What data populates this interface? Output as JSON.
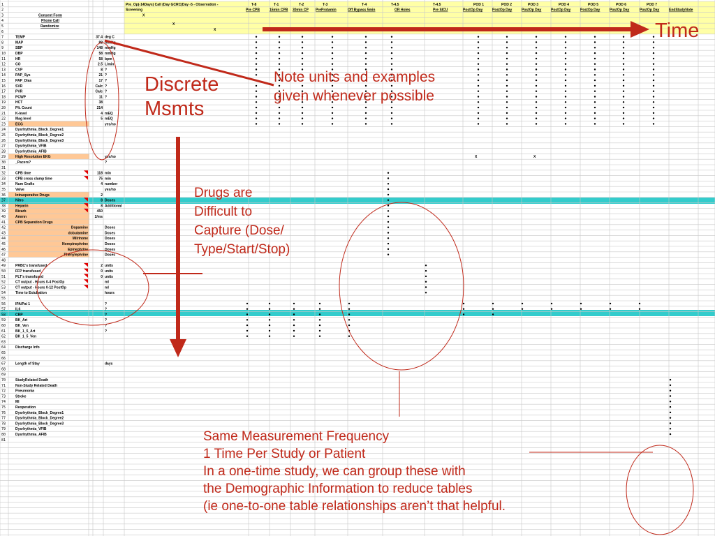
{
  "sheet": {
    "header_row1": "Pre_Op(-14Days) Call (Day GCRC(Day -5 - Observation -",
    "header_row2": "Screening",
    "header_mark": "X",
    "row_labels": {
      "consent": "Consent Form",
      "phone": "Phone Call",
      "randomize": "Randomize"
    },
    "time_columns": [
      "T-8",
      "T-1",
      "T-2",
      "T-3",
      "T-4",
      "T-4.5",
      "T-4.5",
      "POD 1",
      "POD 2",
      "POD 3",
      "POD 4",
      "POD 5",
      "POD 6",
      "POD 7"
    ],
    "subheaders": [
      "Pre CPB",
      "15min CPB",
      "30min CP",
      "PreProtamin",
      "Off Bypass 5min",
      "OR Holes",
      "Pre SICU",
      "PostOp Day",
      "PostOp Day",
      "PostOp Day",
      "PostOp Day",
      "PostOp Day",
      "PostOp Day",
      "PostOp Day",
      "EndStudyNote"
    ],
    "rows": [
      {
        "n": "7",
        "label": "TEMP",
        "val": "37.4",
        "unit": "deg C"
      },
      {
        "n": "8",
        "label": "MAP",
        "val": "88",
        "unit": "mmHg"
      },
      {
        "n": "9",
        "label": "SBP",
        "val": "148",
        "unit": "mmHg"
      },
      {
        "n": "10",
        "label": "DBP",
        "val": "58",
        "unit": "mmHg"
      },
      {
        "n": "11",
        "label": "HR",
        "val": "58",
        "unit": "bpm"
      },
      {
        "n": "12",
        "label": "CO",
        "val": "2.5",
        "unit": "L/min"
      },
      {
        "n": "13",
        "label": "CVP",
        "val": "8",
        "unit": "?"
      },
      {
        "n": "14",
        "label": "PAP_Sys",
        "val": "21",
        "unit": "?"
      },
      {
        "n": "15",
        "label": "PAP_Dias",
        "val": "17",
        "unit": "?"
      },
      {
        "n": "16",
        "label": "SVR",
        "val": "Calc",
        "unit": "?"
      },
      {
        "n": "17",
        "label": "PVR",
        "val": "Calc",
        "unit": "?"
      },
      {
        "n": "18",
        "label": "PCWP",
        "val": "11",
        "unit": "?"
      },
      {
        "n": "19",
        "label": "HCT",
        "val": "38",
        "unit": ""
      },
      {
        "n": "20",
        "label": "Plt. Count",
        "val": "214",
        "unit": ""
      },
      {
        "n": "21",
        "label": "K-level",
        "val": "4",
        "unit": "mEQ"
      },
      {
        "n": "22",
        "label": "Mag level",
        "val": "5",
        "unit": "mEQ"
      },
      {
        "n": "23",
        "label": "ECG",
        "val": "",
        "unit": "yes/no"
      },
      {
        "n": "24",
        "label": "Dysrhythmia_Block_Degree1",
        "val": "",
        "unit": ""
      },
      {
        "n": "25",
        "label": "Dysrhythmia_Block_Degree2",
        "val": "",
        "unit": ""
      },
      {
        "n": "26",
        "label": "Dysrhythmia_Block_Degree3",
        "val": "",
        "unit": ""
      },
      {
        "n": "27",
        "label": "Dysrhythmia_VFIB",
        "val": "",
        "unit": ""
      },
      {
        "n": "28",
        "label": "Dysrhythmia_AFIB",
        "val": "",
        "unit": ""
      },
      {
        "n": "29",
        "label": "High Resolution EKG",
        "val": "",
        "unit": "yes/no"
      },
      {
        "n": "30",
        "label": "_Pacers?",
        "val": "",
        "unit": "?"
      },
      {
        "n": "31",
        "label": "",
        "val": "",
        "unit": ""
      },
      {
        "n": "32",
        "label": "CPB time",
        "val": "118",
        "unit": "min"
      },
      {
        "n": "33",
        "label": "CPB cross clamp time",
        "val": "75",
        "unit": "min"
      },
      {
        "n": "34",
        "label": "Num Grafts",
        "val": "4",
        "unit": "number"
      },
      {
        "n": "35",
        "label": "Valve",
        "val": "",
        "unit": "yes/no"
      },
      {
        "n": "36",
        "label": "Intraoperative Drugs",
        "val": "2",
        "unit": ""
      },
      {
        "n": "37",
        "label": "Nitro",
        "val": "8",
        "unit": "Doses"
      },
      {
        "n": "38",
        "label": "Heparin",
        "val": "8",
        "unit": "Additional"
      },
      {
        "n": "39",
        "label": "Bicarb",
        "val": "450",
        "unit": ""
      },
      {
        "n": "40",
        "label": "Amrnn",
        "val": "2/ms",
        "unit": ""
      },
      {
        "n": "41",
        "label": "CPB Separation Drugs",
        "val": "",
        "unit": ""
      },
      {
        "n": "42",
        "label": "Dopamine",
        "val": "",
        "unit": "Doses"
      },
      {
        "n": "43",
        "label": "dobutamine",
        "val": "",
        "unit": "Doses"
      },
      {
        "n": "44",
        "label": "Milrinone",
        "val": "",
        "unit": "Doses"
      },
      {
        "n": "45",
        "label": "Norepinephrine",
        "val": "",
        "unit": "Doses"
      },
      {
        "n": "46",
        "label": "Epinephrine",
        "val": "",
        "unit": "Doses"
      },
      {
        "n": "47",
        "label": "Phenylephrine",
        "val": "",
        "unit": "Doses"
      },
      {
        "n": "48",
        "label": "",
        "val": "",
        "unit": ""
      },
      {
        "n": "49",
        "label": "PRBC's transfused",
        "val": "2",
        "unit": "units"
      },
      {
        "n": "50",
        "label": "FFP transfused",
        "val": "0",
        "unit": "units"
      },
      {
        "n": "51",
        "label": "PLT's transfused",
        "val": "0",
        "unit": "units"
      },
      {
        "n": "52",
        "label": "CT output - Hours 0-4 PostOp",
        "val": "",
        "unit": "ml"
      },
      {
        "n": "53",
        "label": "CT output - Hours 0-12 PostOp",
        "val": "",
        "unit": "ml"
      },
      {
        "n": "54",
        "label": "Time to Extubation",
        "val": "",
        "unit": "hours"
      },
      {
        "n": "55",
        "label": "",
        "val": "",
        "unit": ""
      },
      {
        "n": "56",
        "label": "IPA/Pai 1",
        "val": "",
        "unit": "?"
      },
      {
        "n": "57",
        "label": "IL6",
        "val": "",
        "unit": "?"
      },
      {
        "n": "58",
        "label": "CRP",
        "val": "",
        "unit": "?"
      },
      {
        "n": "59",
        "label": "BK_Art",
        "val": "",
        "unit": "?"
      },
      {
        "n": "60",
        "label": "BK_Ven",
        "val": "",
        "unit": "?"
      },
      {
        "n": "61",
        "label": "BK_1_5_Art",
        "val": "",
        "unit": "?"
      },
      {
        "n": "62",
        "label": "BK_1_5_Ven",
        "val": "",
        "unit": ""
      },
      {
        "n": "63",
        "label": "",
        "val": "",
        "unit": ""
      },
      {
        "n": "64",
        "label": "Discharge Info",
        "val": "",
        "unit": ""
      },
      {
        "n": "65",
        "label": "",
        "val": "",
        "unit": ""
      },
      {
        "n": "66",
        "label": "",
        "val": "",
        "unit": ""
      },
      {
        "n": "67",
        "label": "Length of Stay",
        "val": "",
        "unit": "days"
      },
      {
        "n": "68",
        "label": "",
        "val": "",
        "unit": ""
      },
      {
        "n": "69",
        "label": "",
        "val": "",
        "unit": ""
      },
      {
        "n": "70",
        "label": "StudyRelated Death",
        "val": "",
        "unit": ""
      },
      {
        "n": "71",
        "label": "Non-Study Related Death",
        "val": "",
        "unit": ""
      },
      {
        "n": "72",
        "label": "Pneumonia",
        "val": "",
        "unit": ""
      },
      {
        "n": "73",
        "label": "Stroke",
        "val": "",
        "unit": ""
      },
      {
        "n": "74",
        "label": "MI",
        "val": "",
        "unit": ""
      },
      {
        "n": "75",
        "label": "Reoperation",
        "val": "",
        "unit": ""
      },
      {
        "n": "76",
        "label": "Dysrhythmia_Block_Degree1",
        "val": "",
        "unit": ""
      },
      {
        "n": "77",
        "label": "Dysrhythmia_Block_Degree2",
        "val": "",
        "unit": ""
      },
      {
        "n": "78",
        "label": "Dysrhythmia_Block_Degree3",
        "val": "",
        "unit": ""
      },
      {
        "n": "79",
        "label": "Dysrhythmia_VFIB",
        "val": "",
        "unit": ""
      },
      {
        "n": "80",
        "label": "Dysrhythmia_AFIB",
        "val": "",
        "unit": ""
      },
      {
        "n": "81",
        "label": "",
        "val": "",
        "unit": ""
      }
    ],
    "x_marks": [
      "X",
      "X"
    ]
  },
  "annotations": {
    "time": "Time",
    "discrete": "Discrete\nMsmts",
    "note": "Note units and examples\ngiven whenever possible",
    "drugs": "Drugs are\nDifficult to\nCapture (Dose/\nType/Start/Stop)",
    "same": "Same Measurement Frequency\n1 Time Per Study or Patient\nIn a one-time study, we can group these with\nthe Demographic Information to reduce tables\n(ie one-to-one table relationships aren’t that helpful."
  },
  "colors": {
    "header_yellow": "#ffffa6",
    "teal_band": "#33cccc",
    "orange_fill": "#ffc896",
    "annotation_red": "#c0291a",
    "grid": "#c8c8c8"
  }
}
